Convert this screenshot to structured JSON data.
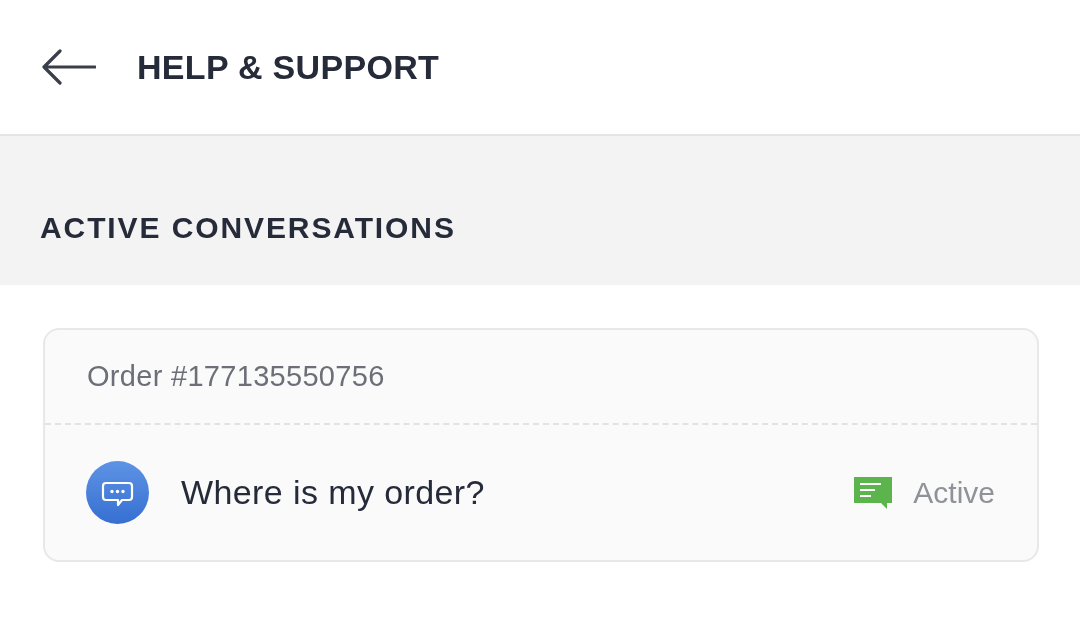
{
  "header": {
    "title": "HELP & SUPPORT"
  },
  "section": {
    "title": "ACTIVE CONVERSATIONS"
  },
  "conversations": [
    {
      "order": "Order #177135550756",
      "topic": "Where is my order?",
      "status": "Active"
    }
  ]
}
